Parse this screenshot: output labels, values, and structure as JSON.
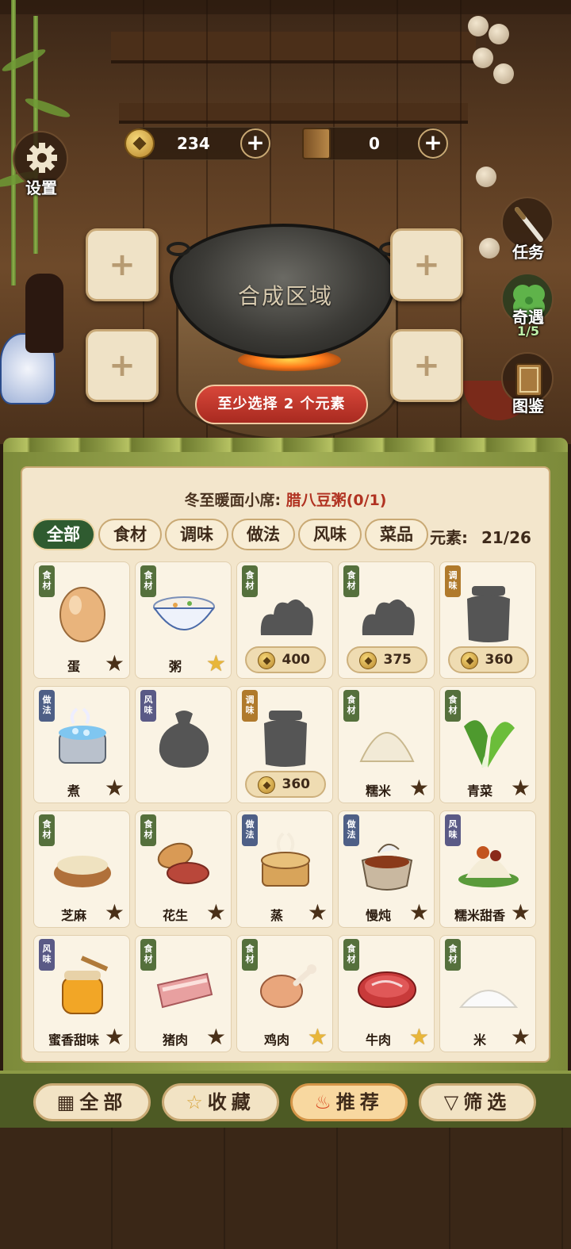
{
  "hud": {
    "settings_label": "设置",
    "coins": "234",
    "books": "0",
    "plus": "+"
  },
  "side_menu": {
    "task_label": "任务",
    "encounter_label": "奇遇",
    "encounter_progress": "1/5",
    "codex_label": "图鉴"
  },
  "craft": {
    "area_label": "合成区域",
    "slot_plus": "+",
    "hint": "至少选择 2 个元素"
  },
  "quest": {
    "prefix": "冬至暖面小席: ",
    "target": "腊八豆粥(0/1)"
  },
  "tabs": [
    {
      "label": "全部",
      "active": true
    },
    {
      "label": "食材",
      "active": false
    },
    {
      "label": "调味",
      "active": false
    },
    {
      "label": "做法",
      "active": false
    },
    {
      "label": "风味",
      "active": false
    },
    {
      "label": "菜品",
      "active": false
    }
  ],
  "element_count": {
    "label": "元素:",
    "value": "21/26"
  },
  "tag_labels": {
    "ingredient": "食材",
    "seasoning": "调味",
    "method": "做法",
    "flavor": "风味"
  },
  "items": [
    {
      "tag": "食材",
      "tagType": "t-ing",
      "name": "蛋",
      "star": "dark",
      "art": "egg"
    },
    {
      "tag": "食材",
      "tagType": "t-ing",
      "name": "粥",
      "star": "gold",
      "art": "porridge"
    },
    {
      "tag": "食材",
      "tagType": "t-ing",
      "name": "",
      "price": "400",
      "art": "locked-pile"
    },
    {
      "tag": "食材",
      "tagType": "t-ing",
      "name": "",
      "price": "375",
      "art": "locked-pile"
    },
    {
      "tag": "调味",
      "tagType": "t-sea",
      "name": "",
      "price": "360",
      "art": "locked-jar"
    },
    {
      "tag": "做法",
      "tagType": "t-met",
      "name": "煮",
      "star": "dark",
      "art": "pot"
    },
    {
      "tag": "风味",
      "tagType": "t-fla",
      "name": "",
      "art": "locked-bag"
    },
    {
      "tag": "调味",
      "tagType": "t-sea",
      "name": "",
      "price": "360",
      "art": "locked-jar"
    },
    {
      "tag": "食材",
      "tagType": "t-ing",
      "name": "糯米",
      "star": "dark",
      "art": "rice-pile"
    },
    {
      "tag": "食材",
      "tagType": "t-ing",
      "name": "青菜",
      "star": "dark",
      "art": "bokchoy"
    },
    {
      "tag": "食材",
      "tagType": "t-ing",
      "name": "芝麻",
      "star": "dark",
      "art": "sesame"
    },
    {
      "tag": "食材",
      "tagType": "t-ing",
      "name": "花生",
      "star": "dark",
      "art": "peanut"
    },
    {
      "tag": "做法",
      "tagType": "t-met",
      "name": "蒸",
      "star": "dark",
      "art": "steamer"
    },
    {
      "tag": "做法",
      "tagType": "t-met",
      "name": "慢炖",
      "star": "dark",
      "art": "claypot"
    },
    {
      "tag": "风味",
      "tagType": "t-fla",
      "name": "糯米甜香",
      "star": "dark",
      "art": "sticky-rice"
    },
    {
      "tag": "风味",
      "tagType": "t-fla",
      "name": "蜜香甜味",
      "star": "dark",
      "art": "honey"
    },
    {
      "tag": "食材",
      "tagType": "t-ing",
      "name": "猪肉",
      "star": "dark",
      "art": "pork"
    },
    {
      "tag": "食材",
      "tagType": "t-ing",
      "name": "鸡肉",
      "star": "gold",
      "art": "chicken"
    },
    {
      "tag": "食材",
      "tagType": "t-ing",
      "name": "牛肉",
      "star": "gold",
      "art": "beef"
    },
    {
      "tag": "食材",
      "tagType": "t-ing",
      "name": "米",
      "star": "dark",
      "art": "rice-grain"
    }
  ],
  "bottom_nav": [
    {
      "label": "全部",
      "icon": "grid-icon",
      "active": false
    },
    {
      "label": "收藏",
      "icon": "star-icon",
      "active": false
    },
    {
      "label": "推荐",
      "icon": "fire-icon",
      "active": true
    },
    {
      "label": "筛选",
      "icon": "filter-icon",
      "active": false
    }
  ],
  "colors": {
    "accent_green": "#2f5b30",
    "hint_red": "#c0392b",
    "quest_red": "#b13322",
    "gold_star": "#e8b63a"
  }
}
